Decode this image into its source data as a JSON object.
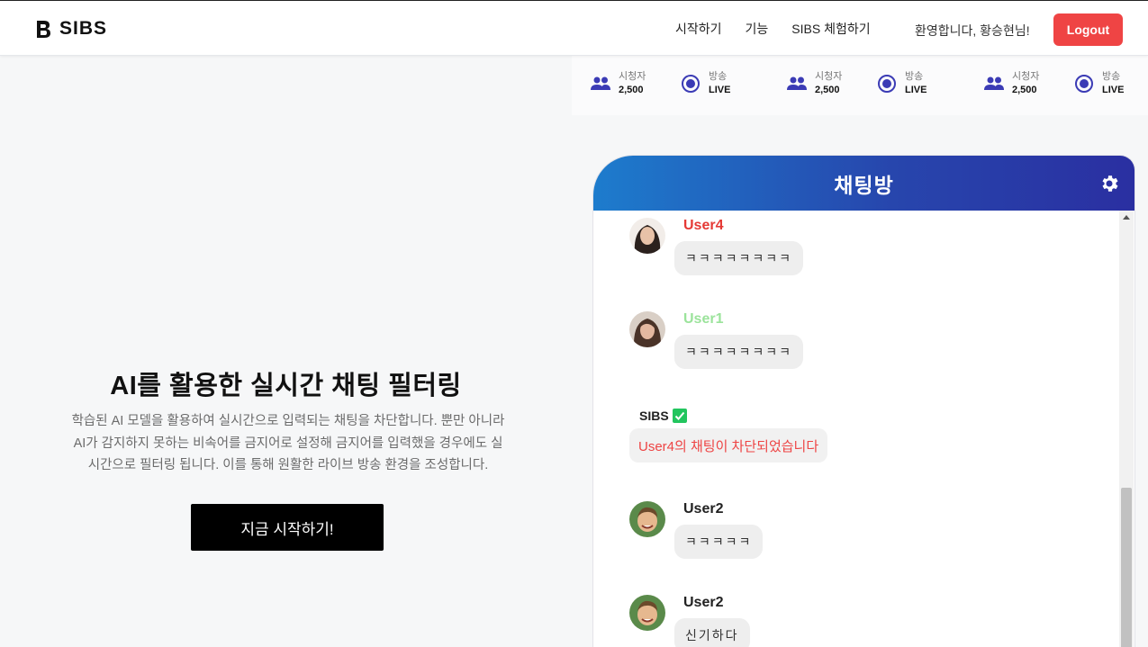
{
  "header": {
    "brand": "SIBS",
    "nav": [
      "시작하기",
      "기능",
      "SIBS 체험하기"
    ],
    "welcome": "환영합니다, 황승현님!",
    "logout_label": "Logout"
  },
  "stats": [
    {
      "viewers_label": "시청자",
      "viewers_value": "2,500",
      "broadcast_label": "방송",
      "broadcast_value": "LIVE"
    },
    {
      "viewers_label": "시청자",
      "viewers_value": "2,500",
      "broadcast_label": "방송",
      "broadcast_value": "LIVE"
    },
    {
      "viewers_label": "시청자",
      "viewers_value": "2,500",
      "broadcast_label": "방송",
      "broadcast_value": "LIVE"
    }
  ],
  "hero": {
    "title": "AI를 활용한 실시간 채팅 필터링",
    "desc_lines": [
      "학습된 AI 모델을 활용하여 실시간으로 입력되는 채팅을 차단합니다. 뿐만 아니라",
      "AI가 감지하지 못하는 비속어를 금지어로 설정해 금지어를 입력했을 경우에도 실",
      "시간으로 필터링 됩니다. 이를 통해 원활한 라이브 방송 환경을 조성합니다."
    ],
    "cta_label": "지금 시작하기!"
  },
  "chat": {
    "title": "채팅방",
    "messages": [
      {
        "user": "User4",
        "user_color": "#e53935",
        "text": "ㅋㅋㅋㅋㅋㅋㅋㅋ",
        "avatar": "woman-dark-hair"
      },
      {
        "user": "User1",
        "user_color": "#9be39b",
        "text": "ㅋㅋㅋㅋㅋㅋㅋㅋ",
        "avatar": "woman-brown-hair"
      },
      {
        "user": "User2",
        "user_color": "#222222",
        "text": "ㅋㅋㅋㅋㅋ",
        "avatar": "boy-smiling"
      },
      {
        "user": "User2",
        "user_color": "#222222",
        "text": "신기하다",
        "avatar": "boy-smiling"
      }
    ],
    "system": {
      "name": "SIBS",
      "badge": "check-icon",
      "text": "User4의 채팅이 차단되었습니다"
    }
  },
  "colors": {
    "logout": "#ef4444",
    "chat_header_start": "#1d7ccd",
    "chat_header_end": "#2a2fa1",
    "stat_icon": "#3b3bb5"
  }
}
